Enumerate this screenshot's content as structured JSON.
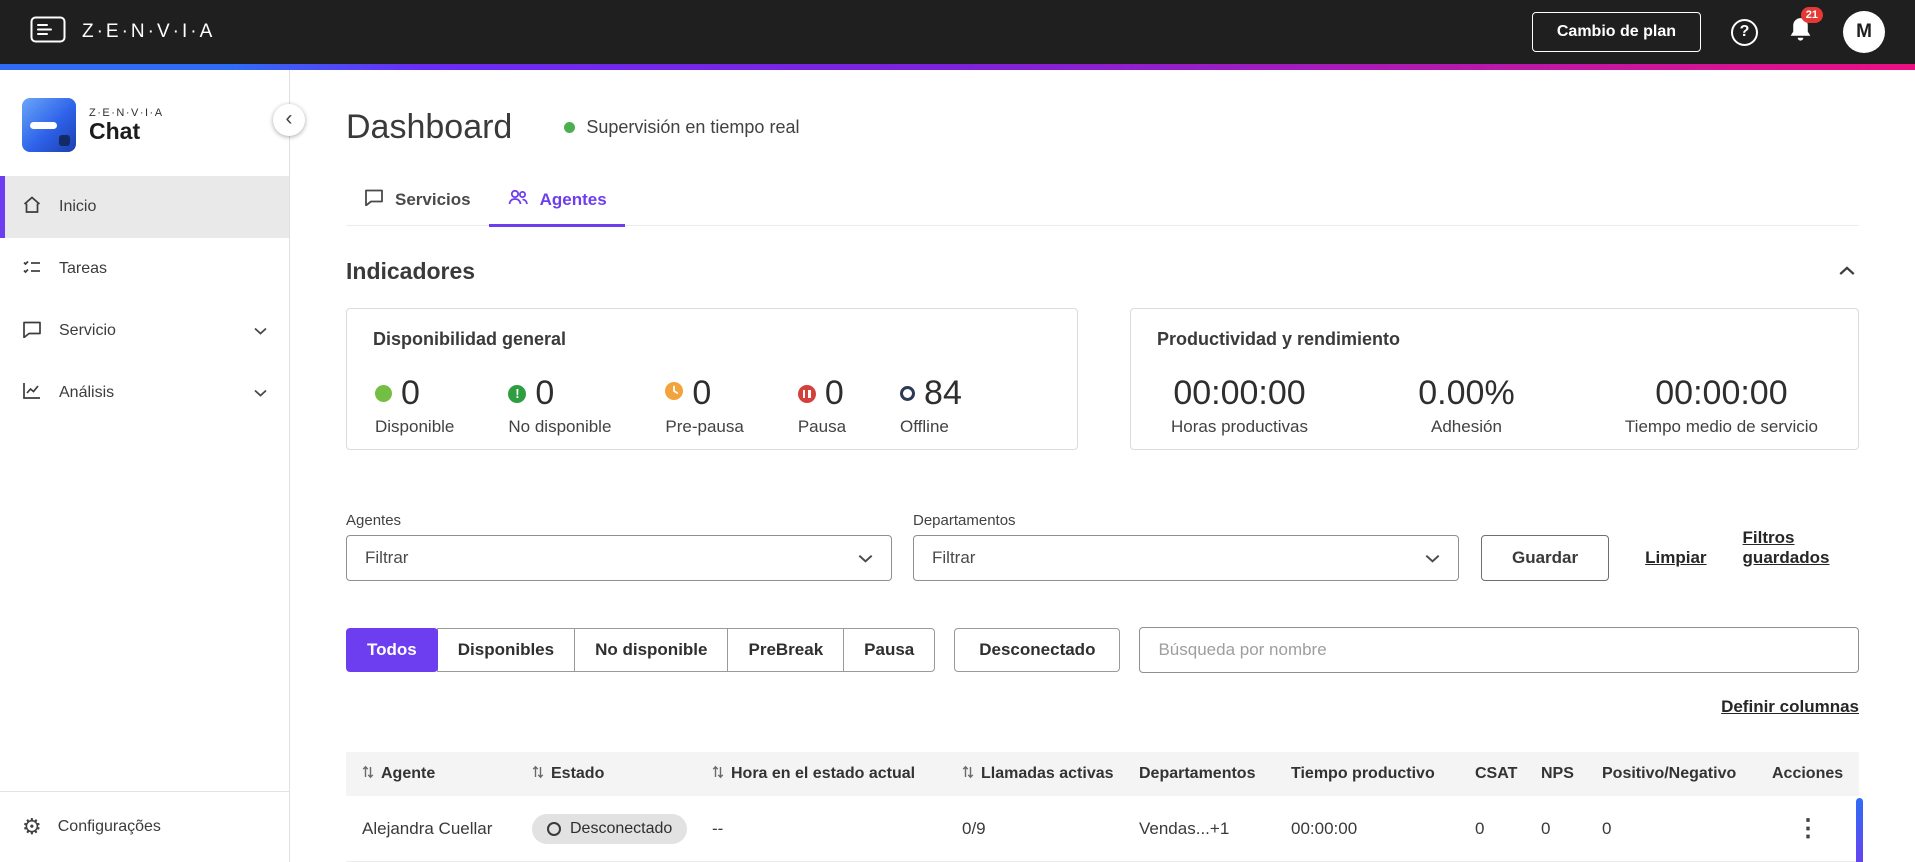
{
  "colors": {
    "accent_purple": "#6d3ef0",
    "topbar_bg": "#1f1f1f",
    "available_green": "#72bf44",
    "unavailable_green": "#2f9e41",
    "prepause_amber": "#f2a33c",
    "pause_red": "#d4403a",
    "offline_navy": "#2b3a55",
    "live_green": "#4caf50",
    "badge_red": "#e53935"
  },
  "icons": {
    "help": "?",
    "collapse": "‹",
    "kebab": "⋮",
    "gear": "⚙"
  },
  "topbar": {
    "brand": "Z·E·N·V·I·A",
    "change_plan": "Cambio de plan",
    "notification_count": "21",
    "avatar_initial": "M"
  },
  "sidebar": {
    "logo_brand": "Z·E·N·V·I·A",
    "logo_product": "Chat",
    "items": [
      {
        "label": "Inicio"
      },
      {
        "label": "Tareas"
      },
      {
        "label": "Servicio"
      },
      {
        "label": "Análisis"
      }
    ],
    "footer": {
      "label": "Configurações"
    }
  },
  "header": {
    "title": "Dashboard",
    "live_status": "Supervisión en tiempo real"
  },
  "tabs": [
    {
      "label": "Servicios"
    },
    {
      "label": "Agentes"
    }
  ],
  "indicators": {
    "section_title": "Indicadores",
    "availability": {
      "title": "Disponibilidad general",
      "items": [
        {
          "value": "0",
          "label": "Disponible"
        },
        {
          "value": "0",
          "label": "No disponible"
        },
        {
          "value": "0",
          "label": "Pre-pausa"
        },
        {
          "value": "0",
          "label": "Pausa"
        },
        {
          "value": "84",
          "label": "Offline"
        }
      ]
    },
    "productivity": {
      "title": "Productividad y rendimiento",
      "items": [
        {
          "value": "00:00:00",
          "label": "Horas productivas"
        },
        {
          "value": "0.00%",
          "label": "Adhesión"
        },
        {
          "value": "00:00:00",
          "label": "Tiempo medio de servicio"
        }
      ]
    }
  },
  "filters": {
    "agents_label": "Agentes",
    "agents_value": "Filtrar",
    "departments_label": "Departamentos",
    "departments_value": "Filtrar",
    "save": "Guardar",
    "clear": "Limpiar",
    "saved": "Filtros guardados"
  },
  "status_filters": [
    {
      "label": "Todos"
    },
    {
      "label": "Disponibles"
    },
    {
      "label": "No disponible"
    },
    {
      "label": "PreBreak"
    },
    {
      "label": "Pausa"
    },
    {
      "label": "Desconectado"
    }
  ],
  "search": {
    "placeholder": "Búsqueda por nombre"
  },
  "table": {
    "define_columns": "Definir columnas",
    "columns": [
      {
        "label": "Agente"
      },
      {
        "label": "Estado"
      },
      {
        "label": "Hora en el estado actual"
      },
      {
        "label": "Llamadas activas"
      },
      {
        "label": "Departamentos"
      },
      {
        "label": "Tiempo productivo"
      },
      {
        "label": "CSAT"
      },
      {
        "label": "NPS"
      },
      {
        "label": "Positivo/Negativo"
      },
      {
        "label": "Acciones"
      }
    ],
    "rows": [
      {
        "agent": "Alejandra Cuellar",
        "status": "Desconectado",
        "time_in_status": "--",
        "active_calls": "0/9",
        "departments": "Vendas...+1",
        "productive_time": "00:00:00",
        "csat": "0",
        "nps": "0",
        "positive_negative": "0"
      }
    ]
  }
}
